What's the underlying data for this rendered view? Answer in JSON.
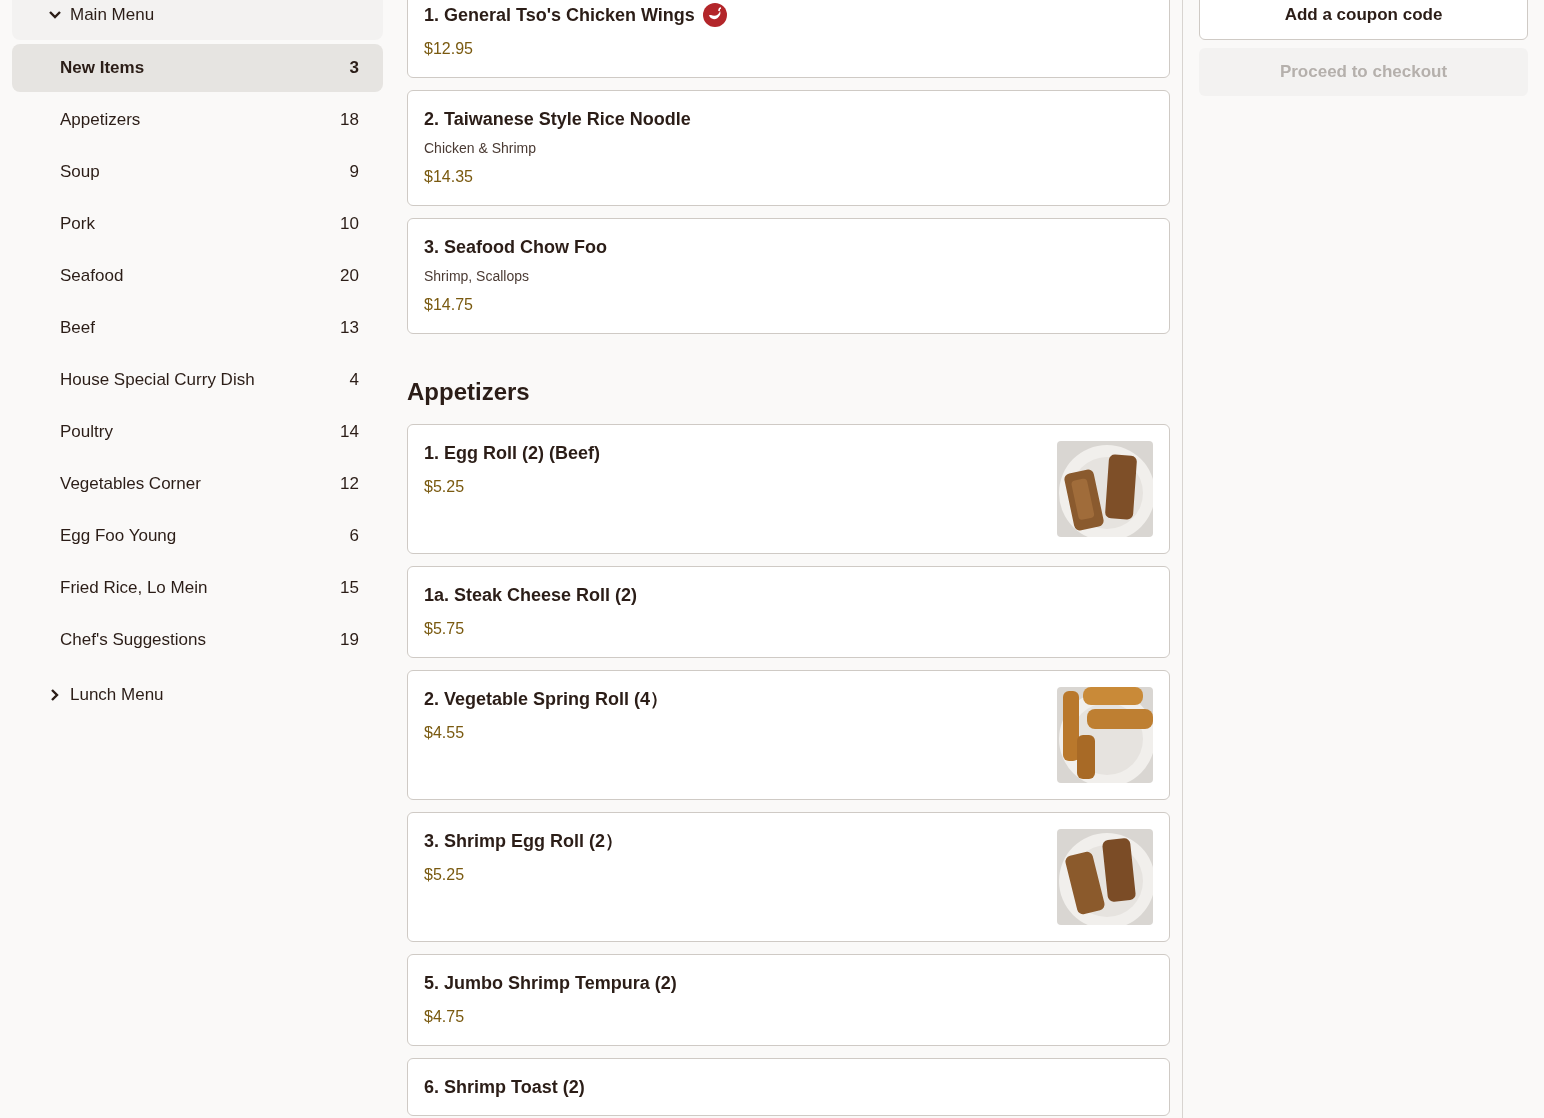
{
  "sidebar": {
    "groups": [
      {
        "label": "Main Menu",
        "expanded": true,
        "items": [
          {
            "label": "New Items",
            "count": "3",
            "selected": true
          },
          {
            "label": "Appetizers",
            "count": "18",
            "selected": false
          },
          {
            "label": "Soup",
            "count": "9",
            "selected": false
          },
          {
            "label": "Pork",
            "count": "10",
            "selected": false
          },
          {
            "label": "Seafood",
            "count": "20",
            "selected": false
          },
          {
            "label": "Beef",
            "count": "13",
            "selected": false
          },
          {
            "label": "House Special Curry Dish",
            "count": "4",
            "selected": false
          },
          {
            "label": "Poultry",
            "count": "14",
            "selected": false
          },
          {
            "label": "Vegetables Corner",
            "count": "12",
            "selected": false
          },
          {
            "label": "Egg Foo Young",
            "count": "6",
            "selected": false
          },
          {
            "label": "Fried Rice, Lo Mein",
            "count": "15",
            "selected": false
          },
          {
            "label": "Chef's Suggestions",
            "count": "19",
            "selected": false
          }
        ]
      },
      {
        "label": "Lunch Menu",
        "expanded": false
      }
    ]
  },
  "sections": [
    {
      "items": [
        {
          "name": "1. General Tso's Chicken Wings",
          "spicy": true,
          "price": "$12.95"
        },
        {
          "name": "2. Taiwanese Style Rice Noodle",
          "description": "Chicken & Shrimp",
          "price": "$14.35"
        },
        {
          "name": "3. Seafood Chow Foo",
          "description": "Shrimp, Scallops",
          "price": "$14.75"
        }
      ]
    },
    {
      "title": "Appetizers",
      "items": [
        {
          "name": "1. Egg Roll (2) (Beef)",
          "price": "$5.25"
        },
        {
          "name": "1a. Steak Cheese Roll (2)",
          "price": "$5.75"
        },
        {
          "name": "2. Vegetable Spring Roll (4）",
          "price": "$4.55"
        },
        {
          "name": "3. Shrimp Egg Roll (2）",
          "price": "$5.25"
        },
        {
          "name": "5. Jumbo Shrimp Tempura (2)",
          "price": "$4.75"
        },
        {
          "name": "6. Shrimp Toast (2)"
        }
      ]
    }
  ],
  "cart": {
    "coupon_button": "Add a coupon code",
    "checkout_button": {
      "label": "Proceed to checkout",
      "disabled": true
    }
  }
}
